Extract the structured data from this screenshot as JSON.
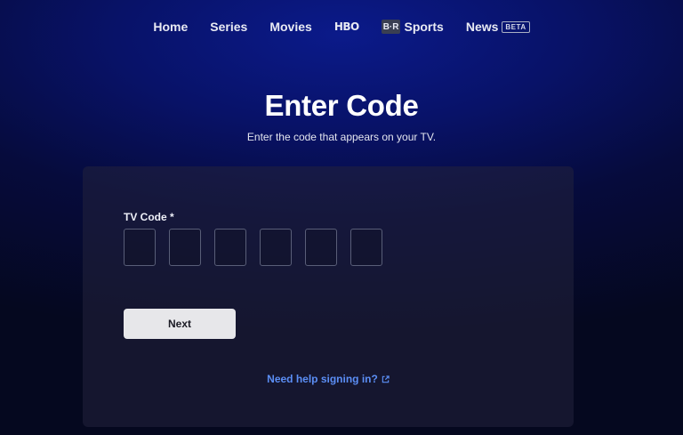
{
  "nav": {
    "items": [
      {
        "label": "Home"
      },
      {
        "label": "Series"
      },
      {
        "label": "Movies"
      },
      {
        "label": "HBO"
      },
      {
        "label": "Sports",
        "logo": "B·R"
      },
      {
        "label": "News",
        "badge": "BETA"
      }
    ]
  },
  "page": {
    "title": "Enter Code",
    "subtitle": "Enter the code that appears on your TV."
  },
  "form": {
    "code_label": "TV Code *",
    "code_boxes": [
      "",
      "",
      "",
      "",
      "",
      ""
    ],
    "next_label": "Next",
    "help_label": "Need help signing in?",
    "help_icon": "external-link-icon"
  },
  "colors": {
    "link": "#5b8ef5",
    "button_bg": "#e7e7ea",
    "background_top": "#0b1a8a",
    "background_bottom": "#05081f"
  }
}
